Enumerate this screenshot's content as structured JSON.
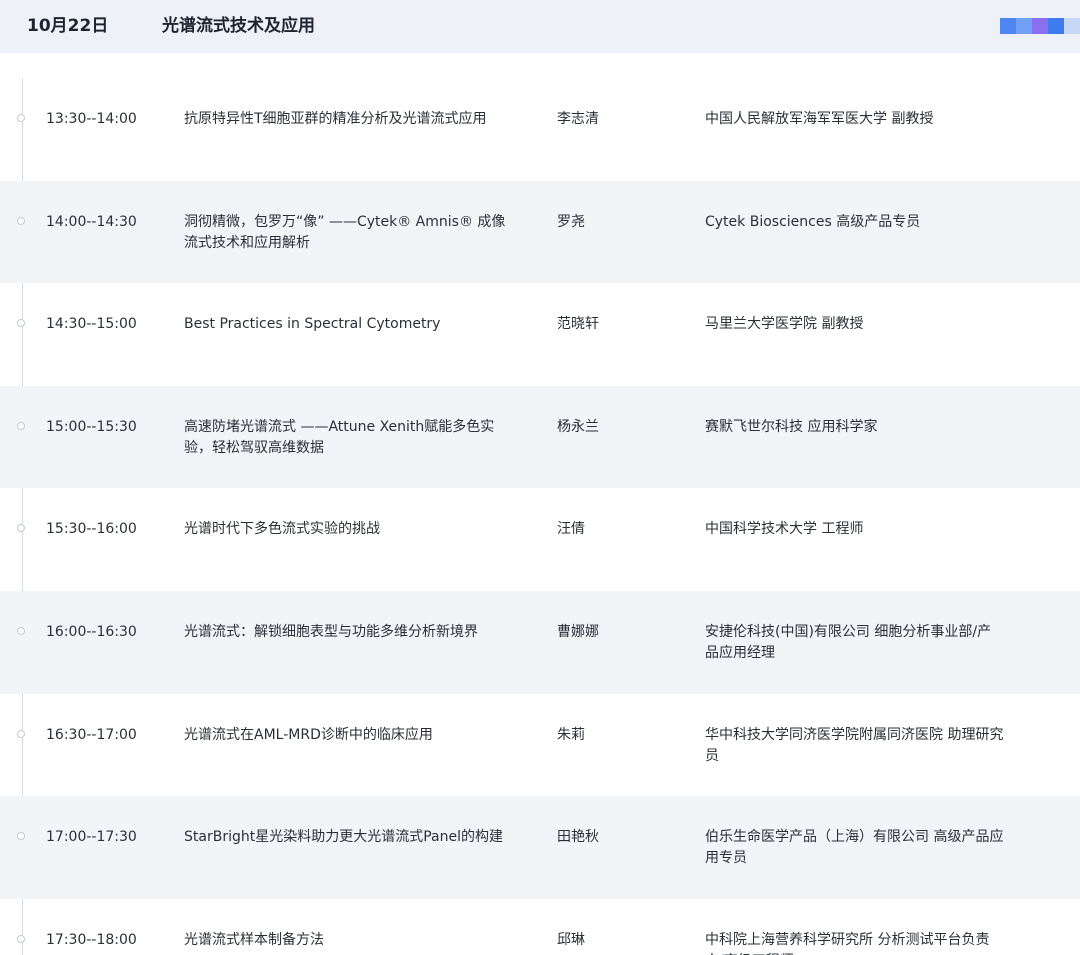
{
  "header": {
    "date": "10月22日",
    "title": "光谱流式技术及应用",
    "bar_colors": [
      "#4f86f2",
      "#6fa0f6",
      "#8a6ff0",
      "#3f7cf0",
      "#c7d7f6"
    ]
  },
  "sessions": [
    {
      "time": "13:30--14:00",
      "topic": "抗原特异性T细胞亚群的精准分析及光谱流式应用",
      "speaker": "李志清",
      "org": "中国人民解放军海军军医大学 副教授"
    },
    {
      "time": "14:00--14:30",
      "topic": "洞彻精微，包罗万“像” ——Cytek® Amnis® 成像流式技术和应用解析",
      "speaker": "罗尧",
      "org": "Cytek Biosciences 高级产品专员"
    },
    {
      "time": "14:30--15:00",
      "topic": "Best Practices in Spectral Cytometry",
      "speaker": "范晓轩",
      "org": "马里兰大学医学院 副教授"
    },
    {
      "time": "15:00--15:30",
      "topic": "高速防堵光谱流式 ——Attune Xenith赋能多色实验，轻松驾驭高维数据",
      "speaker": "杨永兰",
      "org": "赛默飞世尔科技 应用科学家"
    },
    {
      "time": "15:30--16:00",
      "topic": "光谱时代下多色流式实验的挑战",
      "speaker": "汪倩",
      "org": "中国科学技术大学 工程师"
    },
    {
      "time": "16:00--16:30",
      "topic": "光谱流式：解锁细胞表型与功能多维分析新境界",
      "speaker": "曹娜娜",
      "org": "安捷伦科技(中国)有限公司 细胞分析事业部/产品应用经理"
    },
    {
      "time": "16:30--17:00",
      "topic": "光谱流式在AML-MRD诊断中的临床应用",
      "speaker": "朱莉",
      "org": "华中科技大学同济医学院附属同济医院 助理研究员"
    },
    {
      "time": "17:00--17:30",
      "topic": "StarBright星光染料助力更大光谱流式Panel的构建",
      "speaker": "田艳秋",
      "org": "伯乐生命医学产品（上海）有限公司 高级产品应用专员"
    },
    {
      "time": "17:30--18:00",
      "topic": "光谱流式样本制备方法",
      "speaker": "邱琳",
      "org": "中科院上海营养科学研究所 分析测试平台负责人/高级工程师"
    }
  ]
}
